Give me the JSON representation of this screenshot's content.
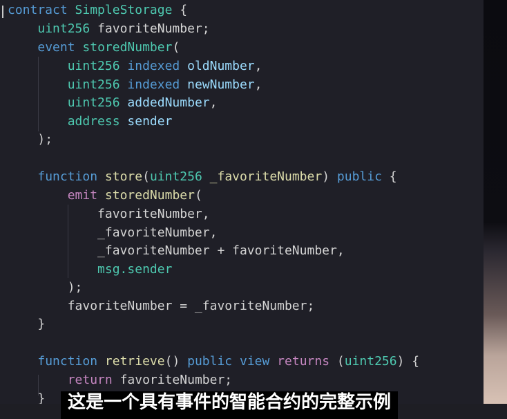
{
  "code": {
    "l1": {
      "kw": "contract",
      "name": "SimpleStorage",
      "brace": "{"
    },
    "l2": {
      "type": "uint256",
      "name": "favoriteNumber",
      "end": ";"
    },
    "l3": {
      "kw": "event",
      "name": "storedNumber",
      "open": "("
    },
    "l4": {
      "type": "uint256",
      "mod": "indexed",
      "name": "oldNumber",
      "end": ","
    },
    "l5": {
      "type": "uint256",
      "mod": "indexed",
      "name": "newNumber",
      "end": ","
    },
    "l6": {
      "type": "uint256",
      "name": "addedNumber",
      "end": ","
    },
    "l7": {
      "type": "address",
      "name": "sender"
    },
    "l8": {
      "text": ");"
    },
    "l10": {
      "kw": "function",
      "name": "store",
      "type": "uint256",
      "param": "_favoriteNumber",
      "vis": "public",
      "brace": "{"
    },
    "l11": {
      "kw": "emit",
      "name": "storedNumber",
      "open": "("
    },
    "l12": {
      "text": "favoriteNumber,"
    },
    "l13": {
      "text": "_favoriteNumber,"
    },
    "l14": {
      "text": "_favoriteNumber + favoriteNumber,"
    },
    "l15": {
      "text": "msg.sender"
    },
    "l16": {
      "text": ");"
    },
    "l17": {
      "text": "favoriteNumber = _favoriteNumber;"
    },
    "l18": {
      "text": "}"
    },
    "l20": {
      "kw": "function",
      "name": "retrieve",
      "vis": "public",
      "mut": "view",
      "ret": "returns",
      "type": "uint256",
      "brace": "{"
    },
    "l21": {
      "kw": "return",
      "text": "favoriteNumber;"
    },
    "l22": {
      "text": "}"
    }
  },
  "subtitle": "这是一个具有事件的智能合约的完整示例"
}
